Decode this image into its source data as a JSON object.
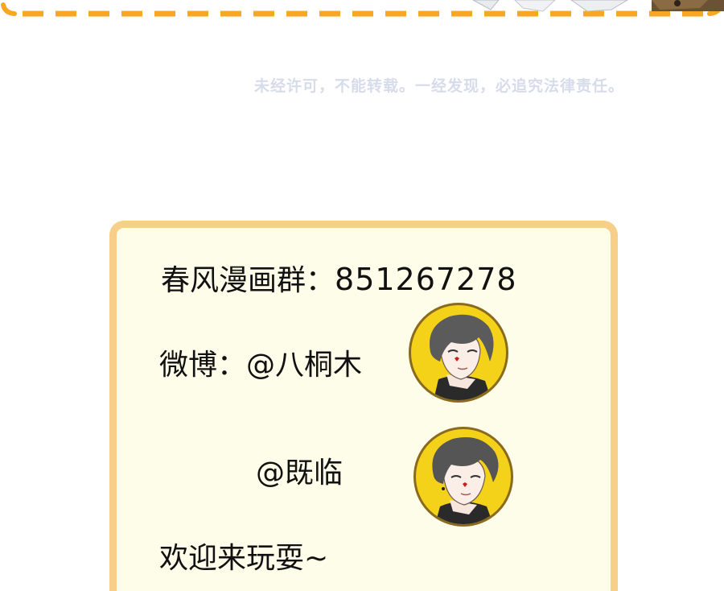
{
  "notice": "未经许可，不能转载。一经发现，必追究法律责任。",
  "card": {
    "group_label": "春风漫画群：",
    "group_number": "851267278",
    "weibo_label": "微博：",
    "weibo_handle_1": "@八桐木",
    "weibo_handle_2": "@既临",
    "welcome": "欢迎来玩耍~"
  },
  "colors": {
    "dash": "#f7a823",
    "card_border": "#f8cf88",
    "card_bg": "#fdfde9",
    "avatar_bg": "#f5d21a",
    "notice_text": "#d7dceb"
  },
  "icons": [
    "avatar-portrait-icon",
    "avatar-portrait-icon"
  ]
}
